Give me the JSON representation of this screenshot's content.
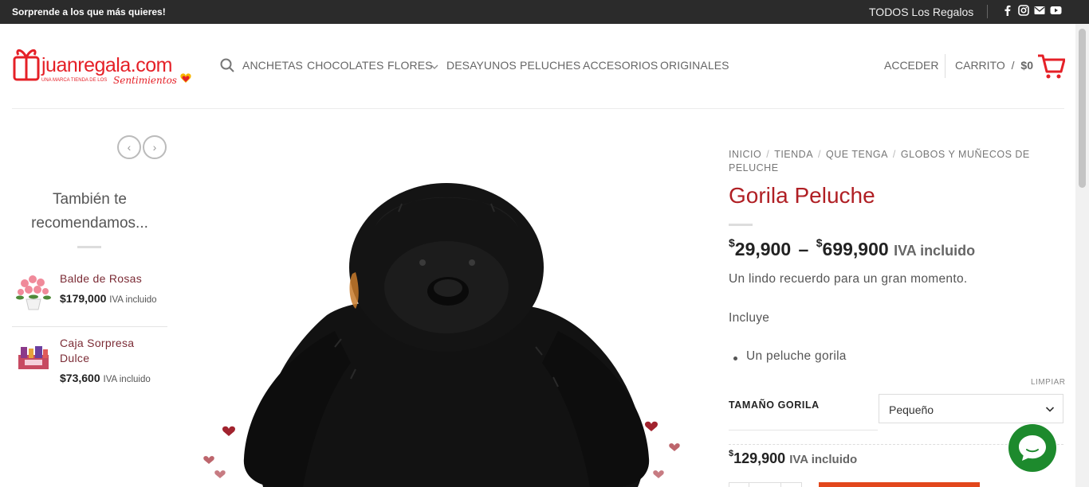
{
  "topbar": {
    "promo": "Sorprende a los que más quieres!",
    "all_gifts": "TODOS Los Regalos",
    "social": [
      "facebook-icon",
      "instagram-icon",
      "mail-icon",
      "youtube-icon"
    ]
  },
  "header": {
    "logo_text": "juanregala.com",
    "logo_tagline": "UNA MARCA TIENDA DE LOS",
    "logo_script": "Sentimientos",
    "nav": [
      "ANCHETAS",
      "CHOCOLATES",
      "FLORES",
      "DESAYUNOS",
      "PELUCHES",
      "ACCESORIOS",
      "ORIGINALES"
    ],
    "login": "ACCEDER",
    "cart_label": "CARRITO",
    "cart_sep": "/",
    "cart_amount": "$0"
  },
  "sidebar": {
    "title": "También te recomendamos...",
    "items": [
      {
        "name": "Balde de Rosas",
        "price": "$179,000",
        "iva": "IVA incluido"
      },
      {
        "name": "Caja Sorpresa Dulce",
        "price": "$73,600",
        "iva": "IVA incluido"
      }
    ]
  },
  "product": {
    "breadcrumb": [
      "INICIO",
      "TIENDA",
      "QUE TENGA",
      "GLOBOS Y MUÑECOS DE PELUCHE"
    ],
    "title": "Gorila Peluche",
    "price_min_symbol": "$",
    "price_min": "29,900",
    "price_dash": "–",
    "price_max_symbol": "$",
    "price_max": "699,900",
    "price_iva": "IVA incluido",
    "short_desc": "Un lindo recuerdo para un gran momento.",
    "includes_label": "Incluye",
    "includes": [
      "Un peluche gorila"
    ],
    "clear_label": "LIMPIAR",
    "variation_label": "TAMAÑO GORILA",
    "variation_value": "Pequeño",
    "variation_price_symbol": "$",
    "variation_price": "129,900",
    "variation_iva": "IVA incluido"
  },
  "colors": {
    "accent": "#b01f24",
    "topbar_bg": "#2b2b2b",
    "chat": "#1d8a2d",
    "add_button": "#e2471c"
  }
}
